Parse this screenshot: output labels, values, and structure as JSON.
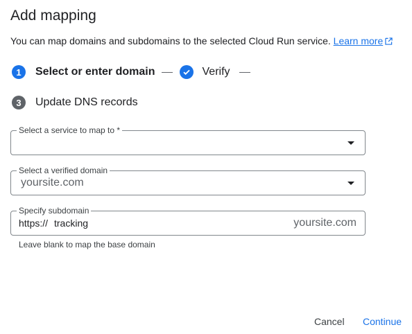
{
  "dialog": {
    "title": "Add mapping",
    "description": "You can map domains and subdomains to the selected Cloud Run service.",
    "learn_more": "Learn more"
  },
  "stepper": {
    "steps": [
      {
        "number": "1",
        "label": "Select or enter domain",
        "state": "active"
      },
      {
        "number": "",
        "label": "Verify",
        "state": "done"
      },
      {
        "number": "3",
        "label": "Update DNS records",
        "state": "pending"
      }
    ]
  },
  "fields": {
    "service": {
      "label": "Select a service to map to *",
      "value": ""
    },
    "domain": {
      "label": "Select a verified domain",
      "value": "yoursite.com"
    },
    "subdomain": {
      "label": "Specify subdomain",
      "prefix": "https://",
      "value": "tracking",
      "suffix": "yoursite.com",
      "hint": "Leave blank to map the base domain"
    }
  },
  "actions": {
    "cancel": "Cancel",
    "continue": "Continue"
  },
  "colors": {
    "accent": "#1a73e8",
    "pending_step": "#5f6368"
  }
}
